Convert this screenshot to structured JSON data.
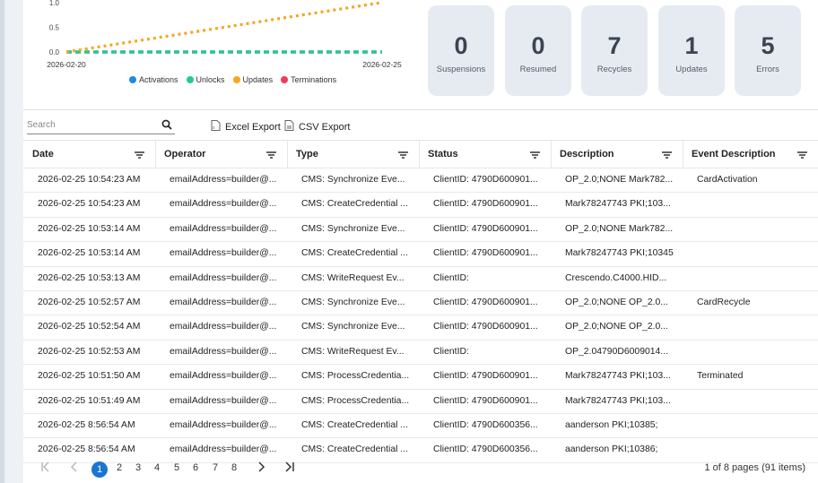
{
  "chart_data": {
    "type": "line",
    "x": [
      "2026-02-20",
      "2026-02-25"
    ],
    "x_tick_labels": [
      "2026-02-20",
      "2026-02-25"
    ],
    "y_ticks": [
      "0.0",
      "0.5",
      "1.0"
    ],
    "ylim": [
      0,
      1.05
    ],
    "legend_position": "bottom",
    "series": [
      {
        "name": "Activations",
        "color": "#1e88e5",
        "values": [
          0,
          0
        ]
      },
      {
        "name": "Unlocks",
        "color": "#1fcc8c",
        "values": [
          0,
          0
        ]
      },
      {
        "name": "Updates",
        "color": "#f5a623",
        "values": [
          0,
          1
        ]
      },
      {
        "name": "Terminations",
        "color": "#ef3b55",
        "values": [
          0,
          0
        ]
      }
    ]
  },
  "stats": [
    {
      "value": "0",
      "label": "Suspensions"
    },
    {
      "value": "0",
      "label": "Resumed"
    },
    {
      "value": "7",
      "label": "Recycles"
    },
    {
      "value": "1",
      "label": "Updates"
    },
    {
      "value": "5",
      "label": "Errors"
    }
  ],
  "toolbar": {
    "search_placeholder": "Search",
    "excel_label": "Excel Export",
    "csv_label": "CSV Export"
  },
  "table": {
    "columns": [
      "Date",
      "Operator",
      "Type",
      "Status",
      "Description",
      "Event Description"
    ],
    "rows": [
      [
        "2026-02-25 10:54:23 AM",
        "emailAddress=builder@...",
        "CMS: Synchronize Eve...",
        "ClientID: 4790D600901...",
        "OP_2.0;NONE Mark782...",
        "CardActivation"
      ],
      [
        "2026-02-25 10:54:23 AM",
        "emailAddress=builder@...",
        "CMS: CreateCredential ...",
        "ClientID: 4790D600901...",
        "Mark78247743 PKI;103...",
        ""
      ],
      [
        "2026-02-25 10:53:14 AM",
        "emailAddress=builder@...",
        "CMS: Synchronize Eve...",
        "ClientID: 4790D600901...",
        "OP_2.0;NONE Mark782...",
        ""
      ],
      [
        "2026-02-25 10:53:14 AM",
        "emailAddress=builder@...",
        "CMS: CreateCredential ...",
        "ClientID: 4790D600901...",
        "Mark78247743 PKI;10345",
        ""
      ],
      [
        "2026-02-25 10:53:13 AM",
        "emailAddress=builder@...",
        "CMS: WriteRequest Ev...",
        "ClientID:",
        "Crescendo.C4000.HID...",
        ""
      ],
      [
        "2026-02-25 10:52:57 AM",
        "emailAddress=builder@...",
        "CMS: Synchronize Eve...",
        "ClientID: 4790D600901...",
        "OP_2.0;NONE OP_2.0...",
        "CardRecycle"
      ],
      [
        "2026-02-25 10:52:54 AM",
        "emailAddress=builder@...",
        "CMS: Synchronize Eve...",
        "ClientID: 4790D600901...",
        "OP_2.0;NONE OP_2.0...",
        ""
      ],
      [
        "2026-02-25 10:52:53 AM",
        "emailAddress=builder@...",
        "CMS: WriteRequest Ev...",
        "ClientID:",
        "OP_2.04790D6009014...",
        ""
      ],
      [
        "2026-02-25 10:51:50 AM",
        "emailAddress=builder@...",
        "CMS: ProcessCredentia...",
        "ClientID: 4790D600901...",
        "Mark78247743 PKI;103...",
        "Terminated"
      ],
      [
        "2026-02-25 10:51:49 AM",
        "emailAddress=builder@...",
        "CMS: ProcessCredentia...",
        "ClientID: 4790D600901...",
        "Mark78247743 PKI;103...",
        ""
      ],
      [
        "2026-02-25 8:56:54 AM",
        "emailAddress=builder@...",
        "CMS: CreateCredential ...",
        "ClientID: 4790D600356...",
        "aanderson PKI;10385;",
        ""
      ],
      [
        "2026-02-25 8:56:54 AM",
        "emailAddress=builder@...",
        "CMS: CreateCredential ...",
        "ClientID: 4790D600356...",
        "aanderson PKI;10386;",
        ""
      ]
    ]
  },
  "pager": {
    "pages": [
      "1",
      "2",
      "3",
      "4",
      "5",
      "6",
      "7",
      "8"
    ],
    "current": "1",
    "info": "1 of 8 pages (91 items)"
  }
}
